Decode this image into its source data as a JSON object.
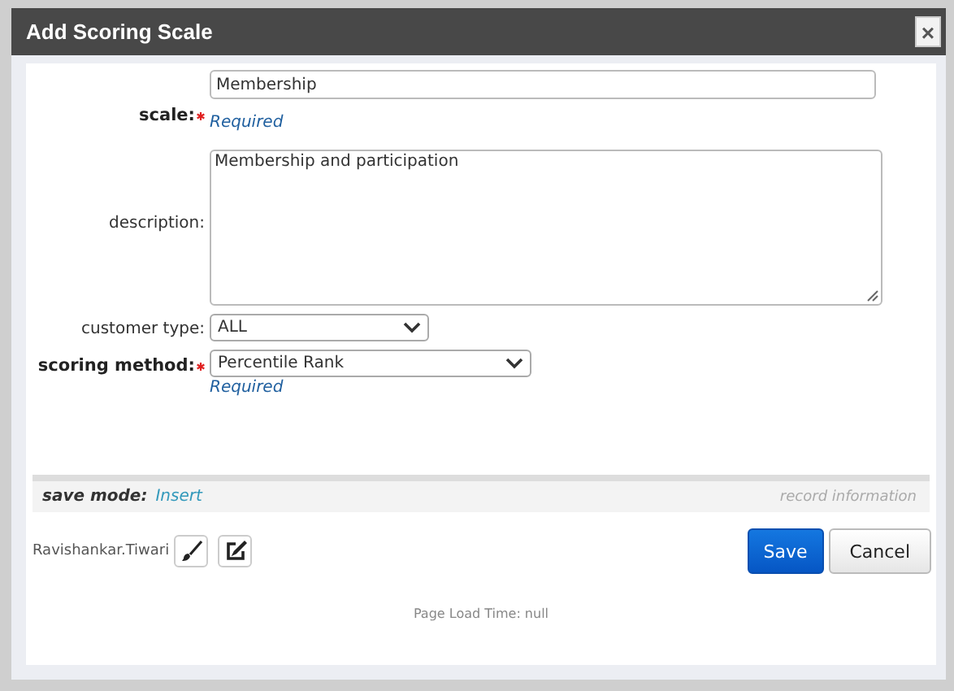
{
  "window": {
    "title": "Add Scoring Scale",
    "close": "×"
  },
  "fields": [
    {
      "kind": "text",
      "label": "scale:",
      "value": "Membership",
      "required": true,
      "note": "Required"
    },
    {
      "kind": "textarea",
      "label": "description:",
      "value": "Membership and participation",
      "required": false
    },
    {
      "kind": "select",
      "label": "customer type:",
      "value": "ALL",
      "required": false
    },
    {
      "kind": "select",
      "label": "scoring method:",
      "value": "Percentile Rank",
      "required": true,
      "note": "Required"
    }
  ],
  "save_mode": {
    "label": "save mode:",
    "value": "Insert",
    "record_info": "record information"
  },
  "footer": {
    "user": "Ravishankar.Tiwari",
    "buttons": [
      {
        "label": "Save",
        "primary": true
      },
      {
        "label": "Cancel",
        "primary": false
      }
    ],
    "page_load": "Page Load Time: null"
  }
}
